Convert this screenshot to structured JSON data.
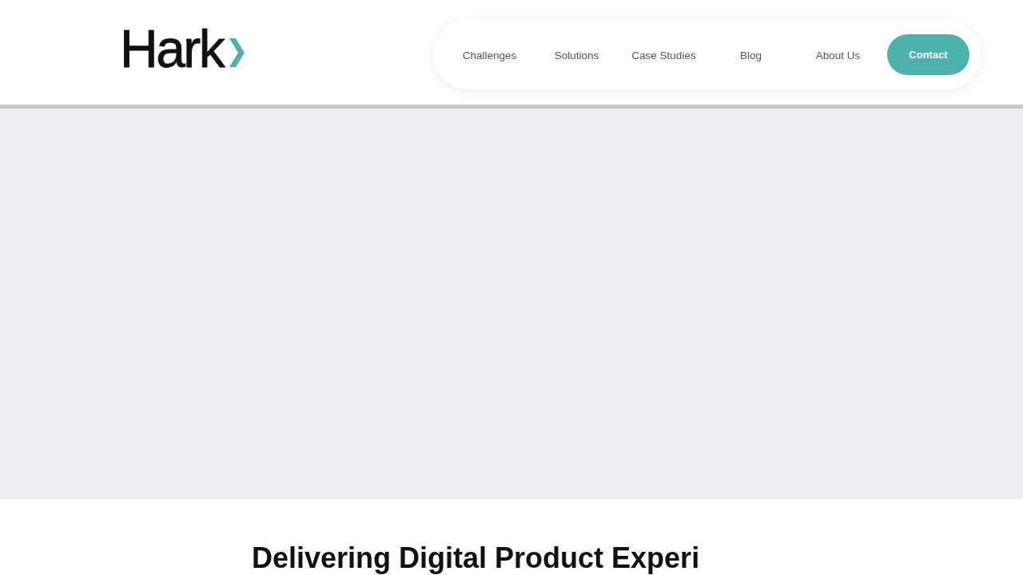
{
  "header": {
    "logo": {
      "text": "Hark"
    },
    "nav": {
      "links": [
        "Challenges",
        "Solutions",
        "Case Studies",
        "Blog",
        "About Us"
      ],
      "contact_button": "Contact"
    }
  },
  "intro": {
    "heading": "Delivering Digital Product Experi"
  }
}
